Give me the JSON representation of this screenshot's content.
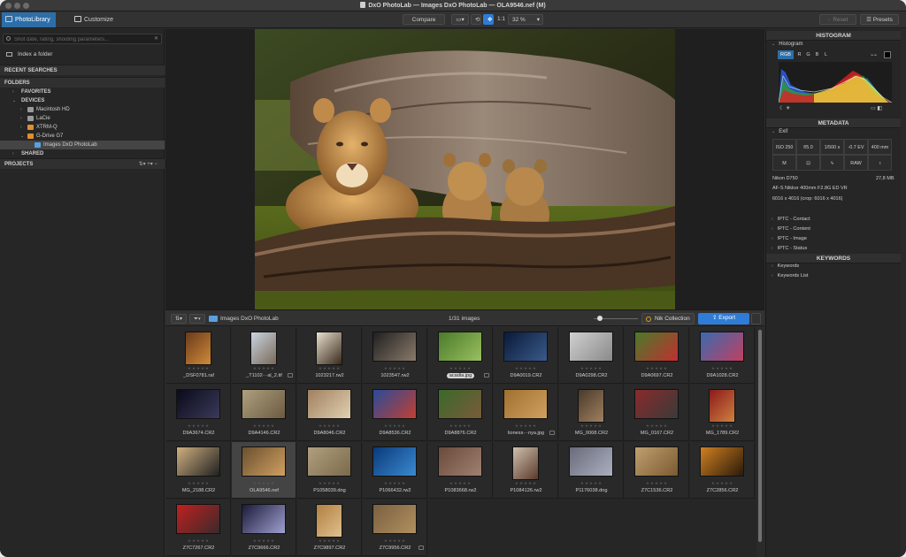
{
  "window": {
    "title": "DxO PhotoLab — Images DxO PhotoLab — OLA9546.nef (M)"
  },
  "toolbar": {
    "tabs": [
      {
        "label": "PhotoLibrary",
        "active": true
      },
      {
        "label": "Customize",
        "active": false
      }
    ],
    "compare_label": "Compare",
    "ratio_label": "1:1",
    "zoom_value": "32 %",
    "reset_label": "Reset",
    "presets_label": "Presets"
  },
  "left_panel": {
    "search_placeholder": "Shot date, rating, shooting parameters...",
    "index_label": "Index a folder",
    "recent_searches_label": "RECENT SEARCHES",
    "folders_label": "FOLDERS",
    "tree": [
      {
        "label": "FAVORITES",
        "level": 1,
        "expanded": false,
        "bold": true
      },
      {
        "label": "DEVICES",
        "level": 1,
        "expanded": true,
        "bold": true
      },
      {
        "label": "Macintosh HD",
        "level": 2,
        "expanded": false,
        "icon": "drive-icon"
      },
      {
        "label": "LaCie",
        "level": 2,
        "expanded": false,
        "icon": "drive-icon"
      },
      {
        "label": "XTRM-Q",
        "level": 2,
        "expanded": false,
        "icon": "external-drive-icon"
      },
      {
        "label": "G-Drive G7",
        "level": 2,
        "expanded": true,
        "icon": "external-drive-icon"
      },
      {
        "label": "Images DxO PhotoLab",
        "level": 3,
        "selected": true,
        "icon": "folder-icon"
      },
      {
        "label": "SHARED",
        "level": 1,
        "expanded": false,
        "bold": true
      }
    ],
    "projects_label": "PROJECTS"
  },
  "filmstrip": {
    "folder_label": "Images DxO PhotoLab",
    "count_label": "1/31 images",
    "zoom_level": 0.08,
    "nik_label": "Nik Collection",
    "export_label": "Export",
    "thumbnails": [
      {
        "name": "_DSF0781.raf",
        "colors": [
          "#6a3a1a",
          "#d08a3a"
        ],
        "w": 30,
        "h": 38
      },
      {
        "name": "_T1102···al_2.tif",
        "colors": [
          "#c8d4e0",
          "#7a6a5a"
        ],
        "w": 30,
        "h": 38,
        "badge": true
      },
      {
        "name": "1023217.rw2",
        "colors": [
          "#e8e0d0",
          "#3a2a1a"
        ],
        "w": 30,
        "h": 38
      },
      {
        "name": "1023547.rw2",
        "colors": [
          "#202020",
          "#8a7a6a"
        ],
        "w": 50,
        "h": 34
      },
      {
        "name": "acadia.jpg",
        "colors": [
          "#4a7a2a",
          "#9ac060"
        ],
        "w": 50,
        "h": 34,
        "tag": true,
        "badge": true
      },
      {
        "name": "D9A0019.CR2",
        "colors": [
          "#0a1a3a",
          "#3a5a8a"
        ],
        "w": 50,
        "h": 34
      },
      {
        "name": "D9A0298.CR2",
        "colors": [
          "#d0d0d0",
          "#8a8a8a"
        ],
        "w": 50,
        "h": 34
      },
      {
        "name": "D9A0697.CR2",
        "colors": [
          "#4a7a2a",
          "#c03030"
        ],
        "w": 50,
        "h": 34
      },
      {
        "name": "D9A1028.CR2",
        "colors": [
          "#3a6ab0",
          "#c04060"
        ],
        "w": 50,
        "h": 34
      },
      {
        "name": "D9A3674.CR2",
        "colors": [
          "#0a0a1a",
          "#3a3a5a"
        ],
        "w": 50,
        "h": 34
      },
      {
        "name": "D9A4146.CR2",
        "colors": [
          "#b0a080",
          "#6a5a40"
        ],
        "w": 50,
        "h": 34
      },
      {
        "name": "D9A8046.CR2",
        "colors": [
          "#a08060",
          "#e0d0b0"
        ],
        "w": 50,
        "h": 34
      },
      {
        "name": "D9A8536.CR2",
        "colors": [
          "#2a4a9a",
          "#c04030"
        ],
        "w": 50,
        "h": 34
      },
      {
        "name": "D9A8876.CR2",
        "colors": [
          "#3a6a2a",
          "#7a5a3a"
        ],
        "w": 50,
        "h": 34
      },
      {
        "name": "lioness···nya.jpg",
        "colors": [
          "#a07030",
          "#d0a060"
        ],
        "w": 50,
        "h": 34,
        "badge": true
      },
      {
        "name": "MG_0068.CR2",
        "colors": [
          "#4a3a2a",
          "#a08060"
        ],
        "w": 30,
        "h": 38
      },
      {
        "name": "MG_0167.CR2",
        "colors": [
          "#8a2a2a",
          "#3a3a3a"
        ],
        "w": 50,
        "h": 34
      },
      {
        "name": "MG_1789.CR2",
        "colors": [
          "#8a1a1a",
          "#d08040"
        ],
        "w": 30,
        "h": 38
      },
      {
        "name": "MG_2188.CR2",
        "colors": [
          "#d0b080",
          "#202020"
        ],
        "w": 50,
        "h": 34
      },
      {
        "name": "OLA9546.nef",
        "colors": [
          "#6a5030",
          "#d0a060"
        ],
        "w": 50,
        "h": 34,
        "selected": true
      },
      {
        "name": "P1058039.dng",
        "colors": [
          "#b0a080",
          "#7a6a4a"
        ],
        "w": 50,
        "h": 34
      },
      {
        "name": "P1066432.rw2",
        "colors": [
          "#0a3a7a",
          "#3a8ad0"
        ],
        "w": 50,
        "h": 34
      },
      {
        "name": "P1083668.rw2",
        "colors": [
          "#6a4a3a",
          "#a08070"
        ],
        "w": 50,
        "h": 34
      },
      {
        "name": "P1084126.rw2",
        "colors": [
          "#d0c0b0",
          "#5a3a2a"
        ],
        "w": 30,
        "h": 38
      },
      {
        "name": "P1176038.dng",
        "colors": [
          "#6a6a7a",
          "#aab0c0"
        ],
        "w": 50,
        "h": 34
      },
      {
        "name": "Z7C1536.CR2",
        "colors": [
          "#c0a070",
          "#7a5a30"
        ],
        "w": 50,
        "h": 34
      },
      {
        "name": "Z7C2856.CR2",
        "colors": [
          "#d08020",
          "#2a1a0a"
        ],
        "w": 50,
        "h": 34
      },
      {
        "name": "Z7C7267.CR2",
        "colors": [
          "#c02020",
          "#3a2a2a"
        ],
        "w": 50,
        "h": 34
      },
      {
        "name": "Z7C9666.CR2",
        "colors": [
          "#1a1a3a",
          "#a0a0d0"
        ],
        "w": 50,
        "h": 34
      },
      {
        "name": "Z7C9897.CR2",
        "colors": [
          "#b08040",
          "#e0c090"
        ],
        "w": 30,
        "h": 38
      },
      {
        "name": "Z7C9956.CR2",
        "colors": [
          "#7a6040",
          "#b09060"
        ],
        "w": 50,
        "h": 34,
        "badge": true
      }
    ]
  },
  "right_panel": {
    "histogram_header": "HISTOGRAM",
    "histogram_label": "Histogram",
    "channels": [
      "RGB",
      "R",
      "G",
      "B",
      "L"
    ],
    "metadata_header": "METADATA",
    "exif_label": "Exif",
    "exif_row1": [
      "ISO 250",
      "f/5.0",
      "1/500 s",
      "-0.7 EV",
      "400 mm"
    ],
    "exif_row2": [
      "M",
      "",
      "",
      "RAW",
      ""
    ],
    "camera": "Nikon D750",
    "file_size": "27,8 MB",
    "lens": "AF-S Nikkor 400mm F2.8G ED VR",
    "dimensions": "6016 x 4016 (crop: 6016 x 4016)",
    "iptc_items": [
      "IPTC - Contact",
      "IPTC - Content",
      "IPTC - Image",
      "IPTC - Status"
    ],
    "keywords_header": "KEYWORDS",
    "keyword_items": [
      "Keywords",
      "Keywords List"
    ]
  }
}
